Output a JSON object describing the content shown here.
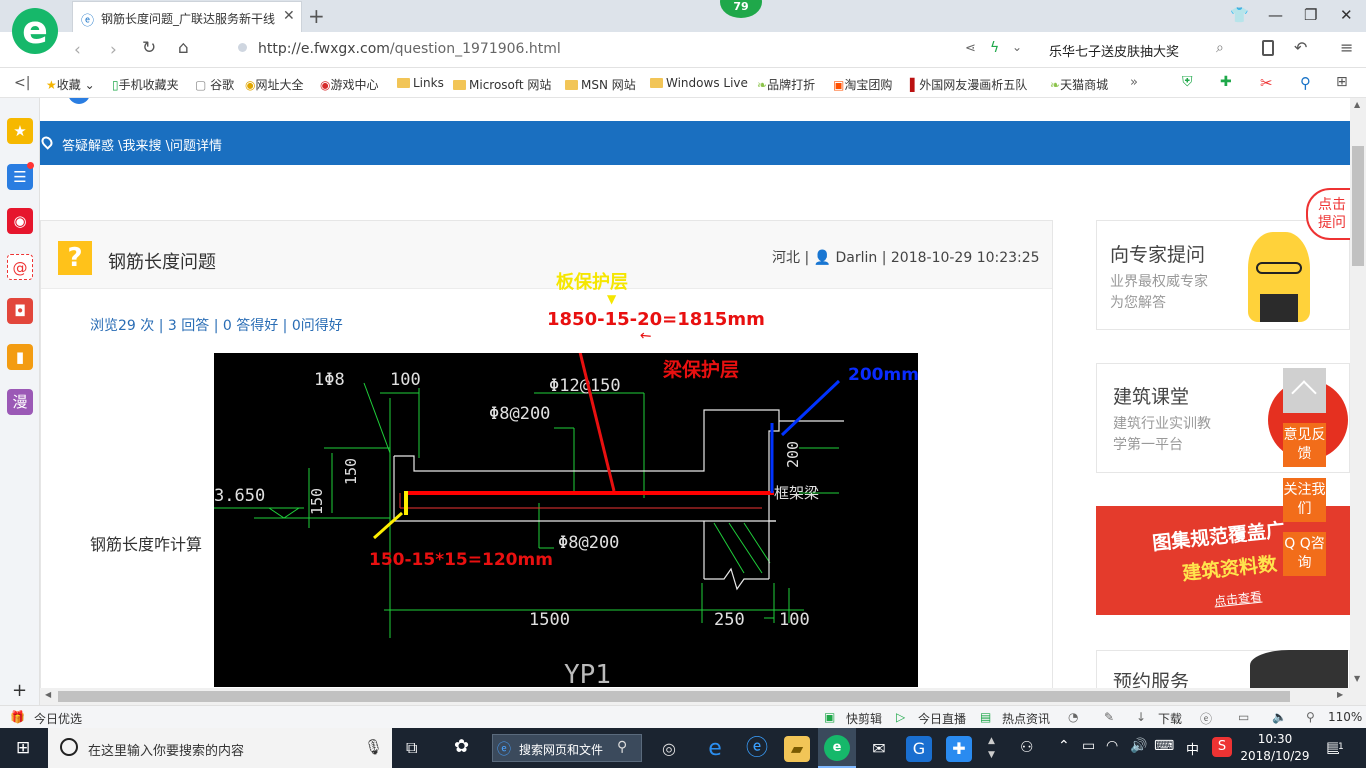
{
  "browser": {
    "tab_title": "钢筋长度问题_广联达服务新干线",
    "badge": "79",
    "url_host": "http://e.fwxgx.com",
    "url_path": "/question_1971906.html",
    "search_promo": "乐华七子送皮肤抽大奖"
  },
  "bookmarks": [
    {
      "label": "收藏"
    },
    {
      "label": "手机收藏夹"
    },
    {
      "label": "谷歌"
    },
    {
      "label": "网址大全"
    },
    {
      "label": "游戏中心"
    },
    {
      "label": "Links"
    },
    {
      "label": "Microsoft 网站"
    },
    {
      "label": "MSN 网站"
    },
    {
      "label": "Windows Live"
    },
    {
      "label": "品牌打折"
    },
    {
      "label": "淘宝团购"
    },
    {
      "label": "外国网友漫画析五队"
    },
    {
      "label": "天猫商城"
    }
  ],
  "sidebar": {
    "manga_label": "漫"
  },
  "page": {
    "breadcrumb": "答疑解惑 \\我来搜 \\问题详情",
    "question_icon": "?",
    "title": "钢筋长度问题",
    "meta": "河北 | 👤 Darlin | 2018-10-29 10:23:25",
    "stats": "浏览29 次 | 3 回答 | 0 答得好 | 0问得好",
    "body": "钢筋长度咋计算"
  },
  "drawing": {
    "labels": {
      "l_1phi8": "1Φ8",
      "l_100a": "100",
      "l_phi12": "Φ12@150",
      "l_phi8a": "Φ8@200",
      "l_150": "150",
      "l_3650": "3.650",
      "l_150b": "150",
      "l_200": "200",
      "l_kjl": "框架梁",
      "l_phi8b": "Φ8@200",
      "l_1500": "1500",
      "l_250": "250",
      "l_100b": "100",
      "l_yp1": "YP1"
    },
    "annotations": {
      "slab_cover": "板保护层",
      "formula_main": "1850-15-20=1815mm",
      "beam_cover": "梁保护层",
      "hook_len": "200mm",
      "formula_end": "150-15*15=120mm"
    }
  },
  "right": {
    "expert_title": "向专家提问",
    "expert_sub1": "业界最权威专家",
    "expert_sub2": "为您解答",
    "class_title": "建筑课堂",
    "class_sub1": "建筑行业实训教",
    "class_sub2": "学第一平台",
    "promo_line1": "图集规范覆盖广",
    "promo_line2": "建筑资料数",
    "promo_cta": "点击查看",
    "booking_title": "预约服务",
    "float_ask": "点击提问",
    "float_feedback": "意见反馈",
    "float_follow": "关注我们",
    "float_qq": "Q Q咨询"
  },
  "status": {
    "today": "今日优选",
    "clip": "快剪辑",
    "live": "今日直播",
    "news": "热点资讯",
    "download": "下载",
    "zoom": "110%"
  },
  "taskbar": {
    "search_placeholder": "在这里输入你要搜索的内容",
    "web_search": "搜索网页和文件",
    "ime": "中",
    "time": "10:30",
    "date": "2018/10/29",
    "notif_count": "1"
  }
}
